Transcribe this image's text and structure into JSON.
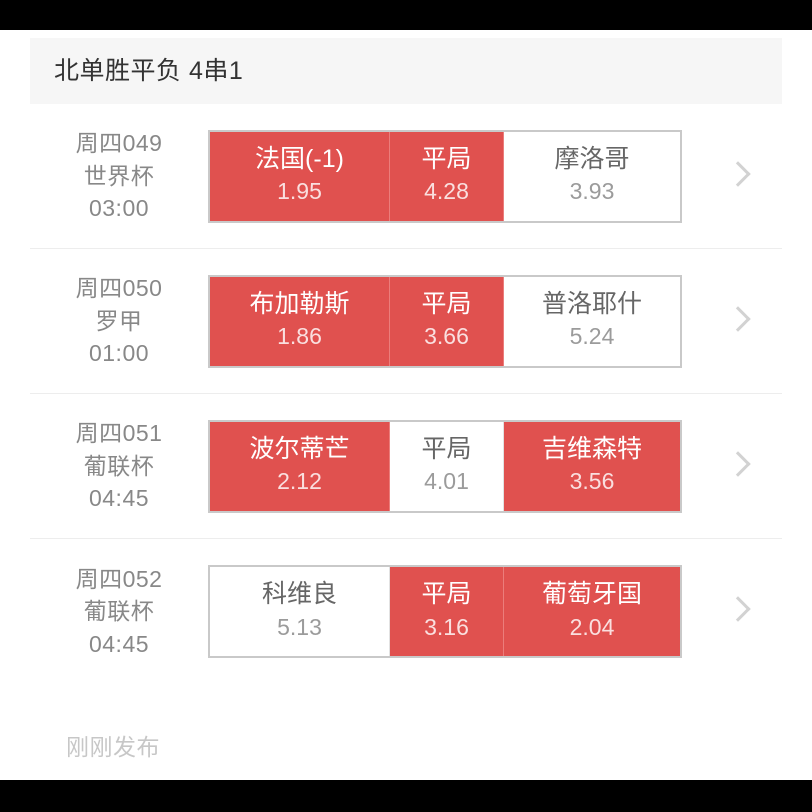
{
  "header": {
    "title": "北单胜平负 4串1",
    "background": "#f6f6f6"
  },
  "colors": {
    "selected": "#e0514f",
    "unselected": "#ffffff",
    "border": "#c9c9c9",
    "text_muted": "#888888"
  },
  "matches": [
    {
      "no": "周四049",
      "league": "世界杯",
      "time": "03:00",
      "chevron": "chevron-right-icon",
      "options": [
        {
          "name": "法国(-1)",
          "odds": "1.95",
          "selected": true
        },
        {
          "name": "平局",
          "odds": "4.28",
          "selected": true
        },
        {
          "name": "摩洛哥",
          "odds": "3.93",
          "selected": false
        }
      ]
    },
    {
      "no": "周四050",
      "league": "罗甲",
      "time": "01:00",
      "chevron": "chevron-right-icon",
      "options": [
        {
          "name": "布加勒斯",
          "odds": "1.86",
          "selected": true
        },
        {
          "name": "平局",
          "odds": "3.66",
          "selected": true
        },
        {
          "name": "普洛耶什",
          "odds": "5.24",
          "selected": false
        }
      ]
    },
    {
      "no": "周四051",
      "league": "葡联杯",
      "time": "04:45",
      "chevron": "chevron-right-icon",
      "options": [
        {
          "name": "波尔蒂芒",
          "odds": "2.12",
          "selected": true
        },
        {
          "name": "平局",
          "odds": "4.01",
          "selected": false
        },
        {
          "name": "吉维森特",
          "odds": "3.56",
          "selected": true
        }
      ]
    },
    {
      "no": "周四052",
      "league": "葡联杯",
      "time": "04:45",
      "chevron": "chevron-right-icon",
      "options": [
        {
          "name": "科维良",
          "odds": "5.13",
          "selected": false
        },
        {
          "name": "平局",
          "odds": "3.16",
          "selected": true
        },
        {
          "name": "葡萄牙国",
          "odds": "2.04",
          "selected": true
        }
      ]
    }
  ],
  "footer": {
    "published": "刚刚发布"
  }
}
